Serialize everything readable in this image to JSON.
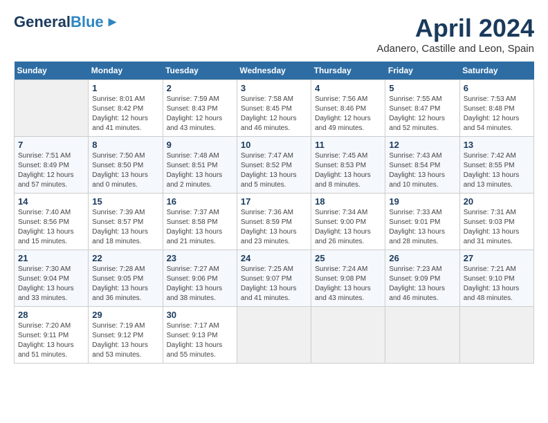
{
  "header": {
    "logo_line1": "General",
    "logo_line2": "Blue",
    "month_title": "April 2024",
    "location": "Adanero, Castille and Leon, Spain"
  },
  "days_of_week": [
    "Sunday",
    "Monday",
    "Tuesday",
    "Wednesday",
    "Thursday",
    "Friday",
    "Saturday"
  ],
  "weeks": [
    [
      {
        "day": "",
        "info": ""
      },
      {
        "day": "1",
        "info": "Sunrise: 8:01 AM\nSunset: 8:42 PM\nDaylight: 12 hours\nand 41 minutes."
      },
      {
        "day": "2",
        "info": "Sunrise: 7:59 AM\nSunset: 8:43 PM\nDaylight: 12 hours\nand 43 minutes."
      },
      {
        "day": "3",
        "info": "Sunrise: 7:58 AM\nSunset: 8:45 PM\nDaylight: 12 hours\nand 46 minutes."
      },
      {
        "day": "4",
        "info": "Sunrise: 7:56 AM\nSunset: 8:46 PM\nDaylight: 12 hours\nand 49 minutes."
      },
      {
        "day": "5",
        "info": "Sunrise: 7:55 AM\nSunset: 8:47 PM\nDaylight: 12 hours\nand 52 minutes."
      },
      {
        "day": "6",
        "info": "Sunrise: 7:53 AM\nSunset: 8:48 PM\nDaylight: 12 hours\nand 54 minutes."
      }
    ],
    [
      {
        "day": "7",
        "info": "Sunrise: 7:51 AM\nSunset: 8:49 PM\nDaylight: 12 hours\nand 57 minutes."
      },
      {
        "day": "8",
        "info": "Sunrise: 7:50 AM\nSunset: 8:50 PM\nDaylight: 13 hours\nand 0 minutes."
      },
      {
        "day": "9",
        "info": "Sunrise: 7:48 AM\nSunset: 8:51 PM\nDaylight: 13 hours\nand 2 minutes."
      },
      {
        "day": "10",
        "info": "Sunrise: 7:47 AM\nSunset: 8:52 PM\nDaylight: 13 hours\nand 5 minutes."
      },
      {
        "day": "11",
        "info": "Sunrise: 7:45 AM\nSunset: 8:53 PM\nDaylight: 13 hours\nand 8 minutes."
      },
      {
        "day": "12",
        "info": "Sunrise: 7:43 AM\nSunset: 8:54 PM\nDaylight: 13 hours\nand 10 minutes."
      },
      {
        "day": "13",
        "info": "Sunrise: 7:42 AM\nSunset: 8:55 PM\nDaylight: 13 hours\nand 13 minutes."
      }
    ],
    [
      {
        "day": "14",
        "info": "Sunrise: 7:40 AM\nSunset: 8:56 PM\nDaylight: 13 hours\nand 15 minutes."
      },
      {
        "day": "15",
        "info": "Sunrise: 7:39 AM\nSunset: 8:57 PM\nDaylight: 13 hours\nand 18 minutes."
      },
      {
        "day": "16",
        "info": "Sunrise: 7:37 AM\nSunset: 8:58 PM\nDaylight: 13 hours\nand 21 minutes."
      },
      {
        "day": "17",
        "info": "Sunrise: 7:36 AM\nSunset: 8:59 PM\nDaylight: 13 hours\nand 23 minutes."
      },
      {
        "day": "18",
        "info": "Sunrise: 7:34 AM\nSunset: 9:00 PM\nDaylight: 13 hours\nand 26 minutes."
      },
      {
        "day": "19",
        "info": "Sunrise: 7:33 AM\nSunset: 9:01 PM\nDaylight: 13 hours\nand 28 minutes."
      },
      {
        "day": "20",
        "info": "Sunrise: 7:31 AM\nSunset: 9:03 PM\nDaylight: 13 hours\nand 31 minutes."
      }
    ],
    [
      {
        "day": "21",
        "info": "Sunrise: 7:30 AM\nSunset: 9:04 PM\nDaylight: 13 hours\nand 33 minutes."
      },
      {
        "day": "22",
        "info": "Sunrise: 7:28 AM\nSunset: 9:05 PM\nDaylight: 13 hours\nand 36 minutes."
      },
      {
        "day": "23",
        "info": "Sunrise: 7:27 AM\nSunset: 9:06 PM\nDaylight: 13 hours\nand 38 minutes."
      },
      {
        "day": "24",
        "info": "Sunrise: 7:25 AM\nSunset: 9:07 PM\nDaylight: 13 hours\nand 41 minutes."
      },
      {
        "day": "25",
        "info": "Sunrise: 7:24 AM\nSunset: 9:08 PM\nDaylight: 13 hours\nand 43 minutes."
      },
      {
        "day": "26",
        "info": "Sunrise: 7:23 AM\nSunset: 9:09 PM\nDaylight: 13 hours\nand 46 minutes."
      },
      {
        "day": "27",
        "info": "Sunrise: 7:21 AM\nSunset: 9:10 PM\nDaylight: 13 hours\nand 48 minutes."
      }
    ],
    [
      {
        "day": "28",
        "info": "Sunrise: 7:20 AM\nSunset: 9:11 PM\nDaylight: 13 hours\nand 51 minutes."
      },
      {
        "day": "29",
        "info": "Sunrise: 7:19 AM\nSunset: 9:12 PM\nDaylight: 13 hours\nand 53 minutes."
      },
      {
        "day": "30",
        "info": "Sunrise: 7:17 AM\nSunset: 9:13 PM\nDaylight: 13 hours\nand 55 minutes."
      },
      {
        "day": "",
        "info": ""
      },
      {
        "day": "",
        "info": ""
      },
      {
        "day": "",
        "info": ""
      },
      {
        "day": "",
        "info": ""
      }
    ]
  ]
}
